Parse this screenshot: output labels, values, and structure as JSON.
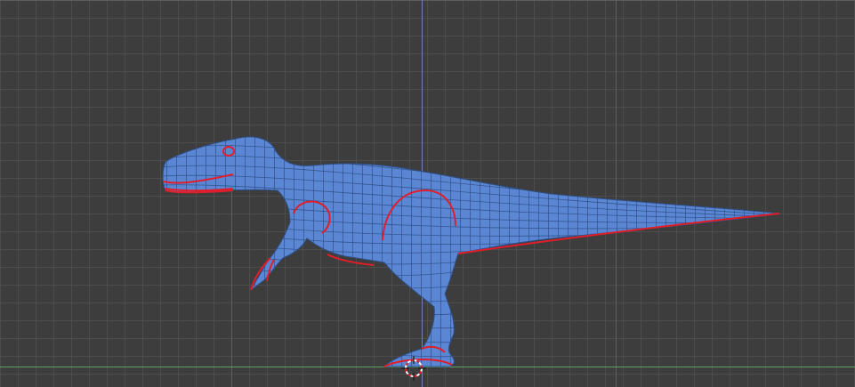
{
  "viewport": {
    "name": "3D Viewport",
    "background_color": "#3d3d3d",
    "grid_line_color": "#4e4e4e",
    "major_grid_color": "#5e5e5e",
    "axis_x_color": "#5fa25f",
    "axis_z_color": "#6b84a8"
  },
  "model": {
    "type": "t-rex-mesh",
    "fill_color": "#5b86d3",
    "wire_color": "#2e4f86",
    "seam_color": "#e01e2a",
    "shading": "solid-with-wireframe"
  },
  "cursor": {
    "icon": "3d-cursor-icon",
    "ring_colors": [
      "#ffffff",
      "#e01e2a"
    ]
  }
}
